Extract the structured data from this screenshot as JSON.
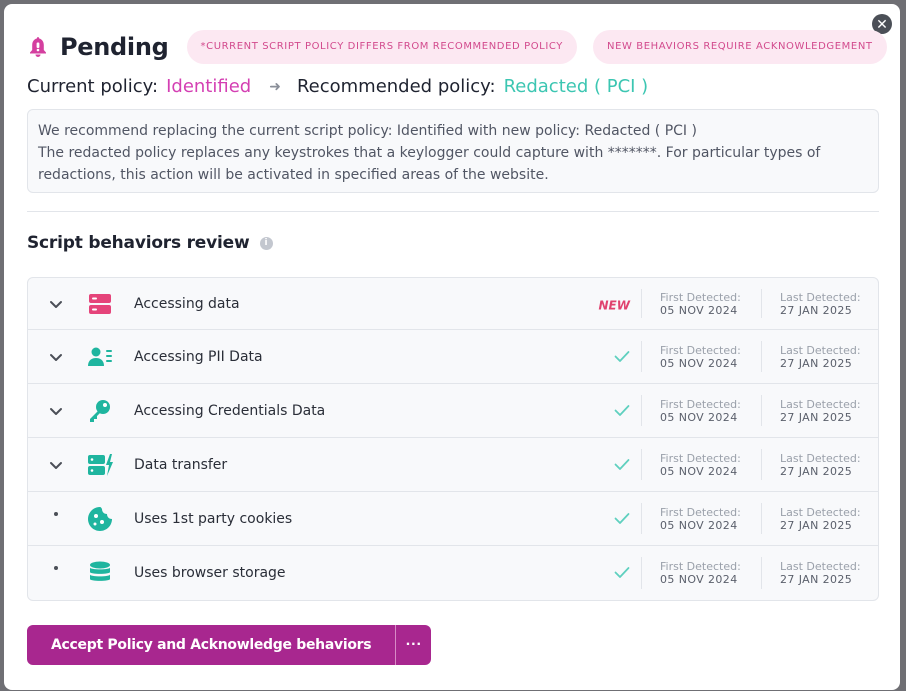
{
  "header": {
    "title": "Pending",
    "badges": [
      "*CURRENT SCRIPT POLICY DIFFERS FROM RECOMMENDED POLICY",
      "NEW BEHAVIORS REQUIRE ACKNOWLEDGEMENT"
    ]
  },
  "policy": {
    "current_label": "Current policy:",
    "current_value": "Identified",
    "recommended_label": "Recommended policy:",
    "recommended_value": "Redacted ( PCI )"
  },
  "info": {
    "line1": "We recommend replacing the current script policy: Identified with new policy: Redacted ( PCI )",
    "line2": "The redacted policy replaces any keystrokes that a keylogger could capture with *******. For particular types of redactions, this action will be activated in specified areas of the website."
  },
  "review": {
    "title": "Script behaviors review",
    "info_icon": "i",
    "first_label": "First Detected:",
    "last_label": "Last Detected:",
    "rows": [
      {
        "label": "Accessing data",
        "icon": "server-icon",
        "expandable": true,
        "status": "NEW",
        "first": "05 NOV 2024",
        "last": "27 JAN 2025"
      },
      {
        "label": "Accessing PII Data",
        "icon": "user-card-icon",
        "expandable": true,
        "status": "check",
        "first": "05 NOV 2024",
        "last": "27 JAN 2025"
      },
      {
        "label": "Accessing Credentials Data",
        "icon": "key-icon",
        "expandable": true,
        "status": "check",
        "first": "05 NOV 2024",
        "last": "27 JAN 2025"
      },
      {
        "label": "Data transfer",
        "icon": "data-transfer-icon",
        "expandable": true,
        "status": "check",
        "first": "05 NOV 2024",
        "last": "27 JAN 2025"
      },
      {
        "label": "Uses 1st party cookies",
        "icon": "cookie-icon",
        "expandable": false,
        "status": "check",
        "first": "05 NOV 2024",
        "last": "27 JAN 2025"
      },
      {
        "label": "Uses browser storage",
        "icon": "database-icon",
        "expandable": false,
        "status": "check",
        "first": "05 NOV 2024",
        "last": "27 JAN 2025"
      }
    ]
  },
  "actions": {
    "accept_label": "Accept Policy and Acknowledge behaviors",
    "more_label": "···"
  },
  "colors": {
    "accent": "#a8278f",
    "current_policy": "#d43fb3",
    "recommended_policy": "#3cc6b2",
    "new_badge": "#e0426e",
    "icon_teal": "#1fb59f",
    "icon_pink": "#e5447a"
  }
}
